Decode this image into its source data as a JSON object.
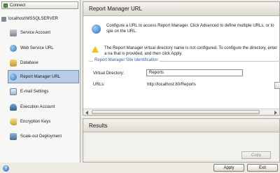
{
  "sidebar": {
    "connect_label": "Connect",
    "server_label": "localhost\\MSSQLSERVER",
    "items": [
      {
        "label": "Service Account",
        "icon": "service-account-icon"
      },
      {
        "label": "Web Service URL",
        "icon": "globe-icon"
      },
      {
        "label": "Database",
        "icon": "database-icon"
      },
      {
        "label": "Report Manager URL",
        "icon": "globe-icon",
        "active": true
      },
      {
        "label": "E-mail Settings",
        "icon": "email-icon"
      },
      {
        "label": "Execution Account",
        "icon": "execution-account-icon"
      },
      {
        "label": "Encryption Keys",
        "icon": "key-icon"
      },
      {
        "label": "Scale-out Deployment",
        "icon": "scale-out-icon"
      }
    ]
  },
  "main": {
    "title": "Report Manager URL",
    "intro_text": "Configure a URL to access Report Manager.  Click Advanced to define multiple URLs, or to spe on the URL.",
    "warning_text": "The Report Manager virtual directory name is not configured. To configure the directory, enter a na that is provided, and then click Apply.",
    "group_label": "Report Manager Site Identification",
    "virtual_directory_label": "Virtual Directory:",
    "virtual_directory_value": "Reports",
    "urls_label": "URLs:",
    "urls_value": "http://localhost:80/Reports"
  },
  "results": {
    "title": "Results",
    "copy_label": "Copy"
  },
  "footer": {
    "apply_label": "Apply",
    "exit_label": "Exit"
  }
}
